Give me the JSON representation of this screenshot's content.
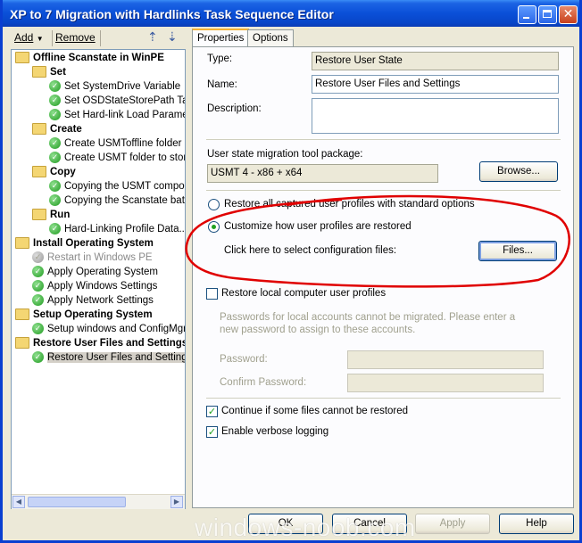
{
  "window": {
    "title": "XP to 7 Migration with Hardlinks Task Sequence Editor"
  },
  "toolbar": {
    "add_label": "Add",
    "remove_label": "Remove"
  },
  "tree": [
    {
      "label": "Offline Scanstate in WinPE",
      "type": "group",
      "style": "bold",
      "level": 0
    },
    {
      "label": "Set",
      "type": "group",
      "style": "bold",
      "level": 1
    },
    {
      "label": "Set SystemDrive Variable",
      "type": "step",
      "style": "normal",
      "level": 2
    },
    {
      "label": "Set OSDStateStorePath Ta",
      "type": "step",
      "style": "normal",
      "level": 2
    },
    {
      "label": "Set Hard-link Load Paramet",
      "type": "step",
      "style": "normal",
      "level": 2
    },
    {
      "label": "Create",
      "type": "group",
      "style": "bold",
      "level": 1
    },
    {
      "label": "Create USMToffline folder",
      "type": "step",
      "style": "normal",
      "level": 2
    },
    {
      "label": "Create USMT folder to stor",
      "type": "step",
      "style": "normal",
      "level": 2
    },
    {
      "label": "Copy",
      "type": "group",
      "style": "bold",
      "level": 1
    },
    {
      "label": "Copying the USMT compone",
      "type": "step",
      "style": "normal",
      "level": 2
    },
    {
      "label": "Copying the Scanstate batc",
      "type": "step",
      "style": "normal",
      "level": 2
    },
    {
      "label": "Run",
      "type": "group",
      "style": "bold",
      "level": 1
    },
    {
      "label": "Hard-Linking Profile Data...",
      "type": "step",
      "style": "normal",
      "level": 2
    },
    {
      "label": "Install Operating System",
      "type": "group",
      "style": "bold",
      "level": 0
    },
    {
      "label": "Restart in Windows PE",
      "type": "step",
      "style": "disabled",
      "level": 1
    },
    {
      "label": "Apply Operating System",
      "type": "step",
      "style": "normal",
      "level": 1
    },
    {
      "label": "Apply Windows Settings",
      "type": "step",
      "style": "normal",
      "level": 1
    },
    {
      "label": "Apply Network Settings",
      "type": "step",
      "style": "normal",
      "level": 1
    },
    {
      "label": "Setup Operating System",
      "type": "group",
      "style": "bold",
      "level": 0
    },
    {
      "label": "Setup windows and ConfigMgr",
      "type": "step",
      "style": "normal",
      "level": 1
    },
    {
      "label": "Restore User Files and Settings",
      "type": "group",
      "style": "bold",
      "level": 0
    },
    {
      "label": "Restore User Files and Settings",
      "type": "step",
      "style": "selected",
      "level": 1
    }
  ],
  "tabs": {
    "properties": "Properties",
    "options": "Options"
  },
  "props": {
    "type_label": "Type:",
    "type_value": "Restore User State",
    "name_label": "Name:",
    "name_value": "Restore User Files and Settings",
    "description_label": "Description:",
    "description_value": "",
    "package_label": "User state migration tool package:",
    "package_value": "USMT 4 - x86 + x64",
    "browse_label": "Browse...",
    "radio_all_label": "Restore all captured user profiles with standard options",
    "radio_custom_label": "Customize how user profiles are restored",
    "config_label": "Click here to select configuration files:",
    "files_label": "Files...",
    "restore_local_label": "Restore local computer user profiles",
    "restore_local_checked": false,
    "password_note": "Passwords for local accounts cannot be migrated. Please enter a new password to assign to these accounts.",
    "password_label": "Password:",
    "confirm_label": "Confirm Password:",
    "continue_label": "Continue if some files cannot be restored",
    "continue_checked": true,
    "verbose_label": "Enable verbose logging",
    "verbose_checked": true
  },
  "buttons": {
    "ok": "OK",
    "cancel": "Cancel",
    "apply": "Apply",
    "help": "Help"
  },
  "watermark": "windows-noob.com",
  "colors": {
    "title_bar": "#0a4fd8",
    "annotation": "#e00000",
    "check_green": "#21a121"
  }
}
